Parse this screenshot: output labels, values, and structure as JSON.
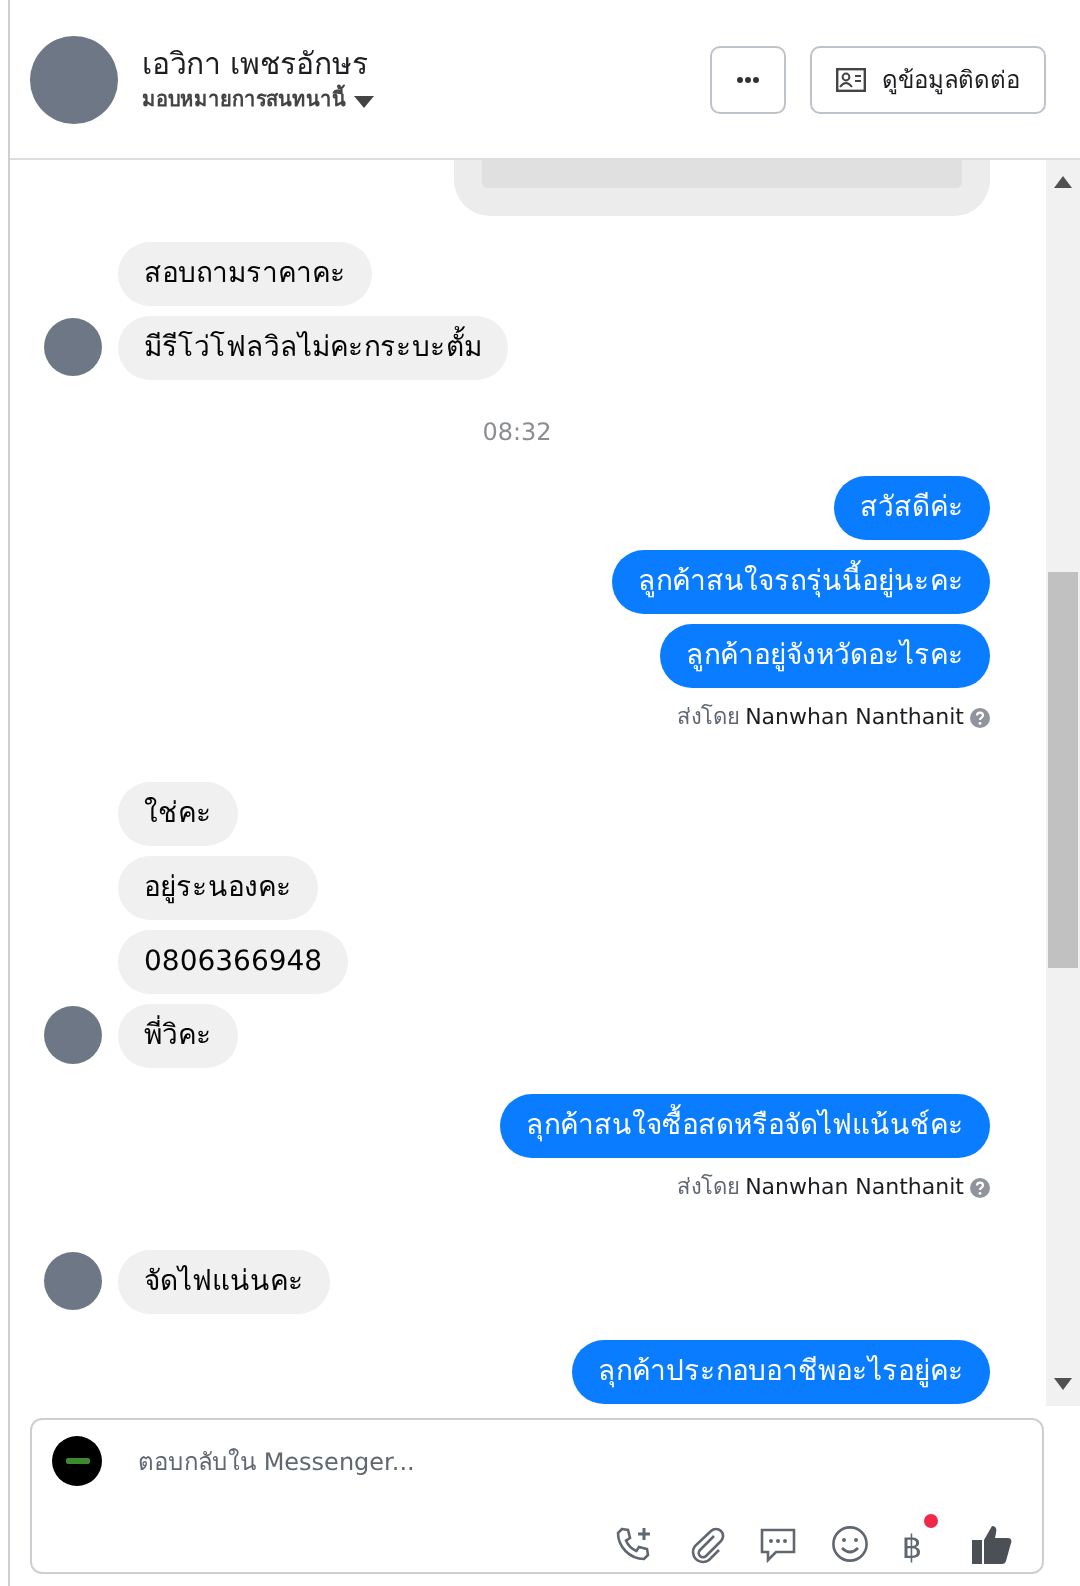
{
  "header": {
    "name": "เอวิกา เพชรอักษร",
    "assign_label": "มอบหมายการสนทนานี้",
    "contact_button": "ดูข้อมูลติดต่อ"
  },
  "messages": [
    {
      "kind": "cut_card"
    },
    {
      "kind": "incoming",
      "texts": [
        "สอบถามราคาคะ",
        "มีรีโว่โฟลวิลไม่คะกระบะตั้ม"
      ]
    },
    {
      "kind": "time",
      "text": "08:32"
    },
    {
      "kind": "outgoing",
      "texts": [
        "สวัสดีค่ะ",
        "ลูกค้าสนใจรถรุ่นนี้อยู่นะคะ",
        "ลูกค้าอยู่จังหวัดอะไรคะ"
      ],
      "sent_by_label": "ส่งโดย",
      "sent_by_name": "Nanwhan Nanthanit"
    },
    {
      "kind": "incoming",
      "texts": [
        "ใช่คะ",
        "อยู่ระนองคะ",
        "0806366948",
        "พี่วิคะ"
      ]
    },
    {
      "kind": "outgoing",
      "texts": [
        "ลุกค้าสนใจซื้อสดหรือจัดไฟแน้นช์คะ"
      ],
      "sent_by_label": "ส่งโดย",
      "sent_by_name": "Nanwhan Nanthanit"
    },
    {
      "kind": "incoming",
      "texts": [
        "จัดไฟแน่นคะ"
      ]
    },
    {
      "kind": "outgoing",
      "texts": [
        "ลุกค้าประกอบอาชีพอะไรอยู่คะ"
      ]
    }
  ],
  "composer": {
    "placeholder": "ตอบกลับใน Messenger...",
    "currency_symbol": "฿",
    "currency_notification": true
  }
}
